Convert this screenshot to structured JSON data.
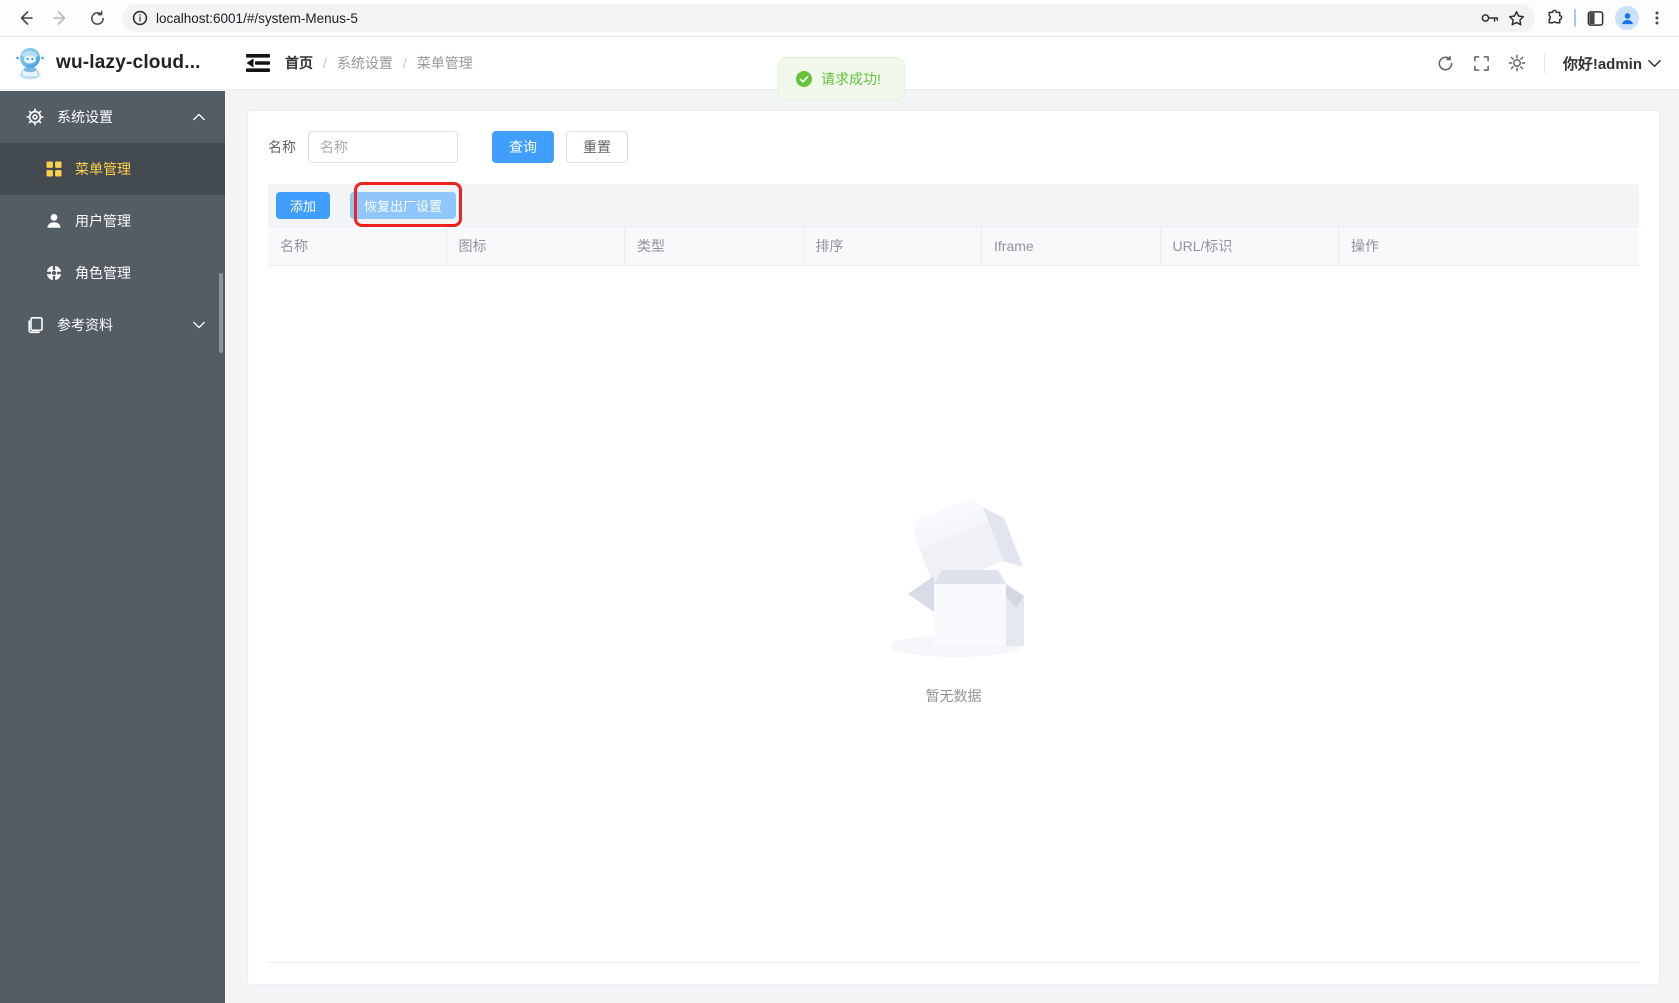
{
  "browser": {
    "url": "localhost:6001/#/system-Menus-5"
  },
  "header": {
    "app_title": "wu-lazy-cloud...",
    "breadcrumb": [
      "首页",
      "系统设置",
      "菜单管理"
    ],
    "greeting": "你好!admin"
  },
  "toast": {
    "message": "请求成功!"
  },
  "sidebar": {
    "items": [
      {
        "label": "系统设置",
        "icon": "gear-icon",
        "state": "expanded"
      },
      {
        "label": "菜单管理",
        "icon": "grid-icon",
        "state": "active"
      },
      {
        "label": "用户管理",
        "icon": "user-icon",
        "state": "normal"
      },
      {
        "label": "角色管理",
        "icon": "role-icon",
        "state": "normal"
      },
      {
        "label": "参考资料",
        "icon": "document-icon",
        "state": "collapsed"
      }
    ]
  },
  "filters": {
    "name_label": "名称",
    "name_placeholder": "名称",
    "name_value": "",
    "search_label": "查询",
    "reset_label": "重置"
  },
  "toolbar": {
    "add_label": "添加",
    "factory_reset_label": "恢复出厂设置"
  },
  "table": {
    "columns": [
      "名称",
      "图标",
      "类型",
      "排序",
      "Iframe",
      "URL/标识",
      "操作"
    ],
    "rows": [],
    "empty_text": "暂无数据"
  },
  "colors": {
    "primary": "#409eff",
    "primary_light": "#8fc6fc",
    "sidebar_bg": "#545c64",
    "sidebar_active_bg": "#434a50",
    "sidebar_active_text": "#ffd04b",
    "success": "#67c23a",
    "annotation_red": "#ee2222"
  }
}
